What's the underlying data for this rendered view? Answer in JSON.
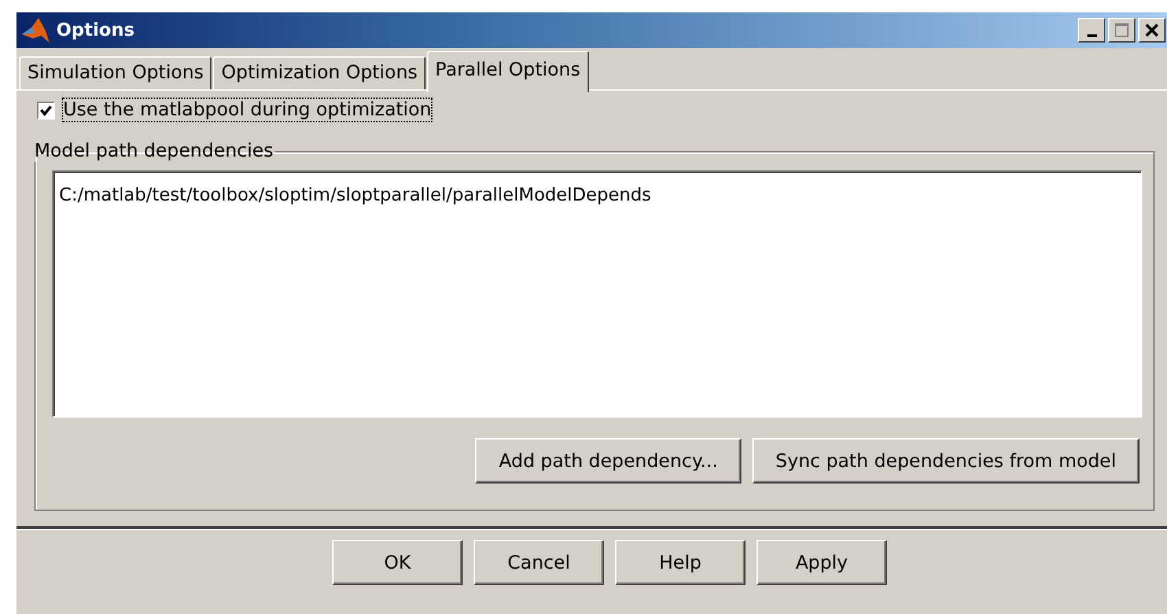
{
  "window": {
    "title": "Options"
  },
  "tabs": [
    {
      "label": "Simulation Options",
      "selected": false
    },
    {
      "label": "Optimization Options",
      "selected": false
    },
    {
      "label": "Parallel Options",
      "selected": true
    }
  ],
  "use_matlabpool": {
    "label": "Use the matlabpool during optimization",
    "checked": true
  },
  "model_path_dependencies": {
    "title": "Model path dependencies",
    "paths": [
      "C:/matlab/test/toolbox/sloptim/sloptparallel/parallelModelDepends"
    ],
    "buttons": [
      "Add path dependency...",
      "Sync path dependencies from model"
    ]
  },
  "buttons": [
    "OK",
    "Cancel",
    "Help",
    "Apply"
  ]
}
